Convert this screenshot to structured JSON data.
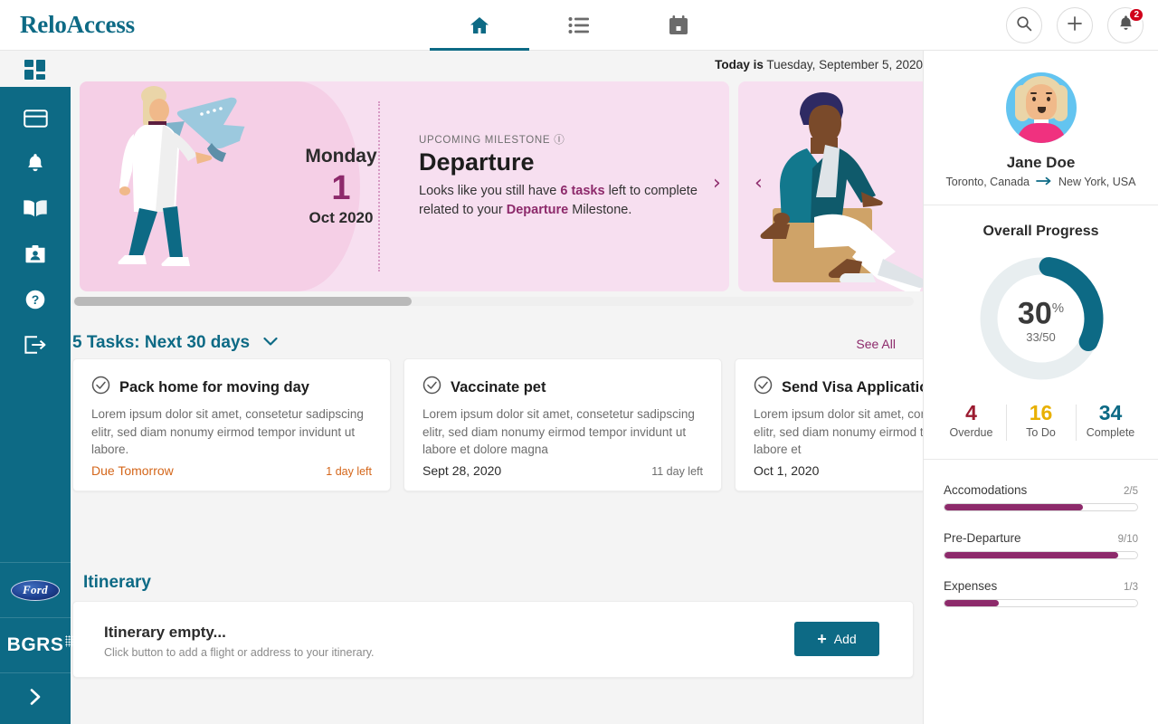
{
  "brand": {
    "logo": "ReloAccess"
  },
  "topnav": {
    "tabs": [
      {
        "icon": "home-icon",
        "label": "Home",
        "active": true
      },
      {
        "icon": "list-icon",
        "label": "Tasks",
        "active": false
      },
      {
        "icon": "calendar-icon",
        "label": "Calendar",
        "active": false
      }
    ],
    "actions": [
      {
        "icon": "search-icon",
        "label": "Search"
      },
      {
        "icon": "plus-icon",
        "label": "Add"
      },
      {
        "icon": "bell-icon",
        "label": "Notifications",
        "badge": "2"
      }
    ]
  },
  "sidebar": {
    "dashboard": {
      "icon": "dashboard-grid-icon",
      "label": "Dashboard"
    },
    "items": [
      {
        "icon": "card-icon",
        "label": "Payments"
      },
      {
        "icon": "bell-icon",
        "label": "Alerts"
      },
      {
        "icon": "book-icon",
        "label": "Guides"
      },
      {
        "icon": "contact-card-icon",
        "label": "Contacts"
      },
      {
        "icon": "help-circle-icon",
        "label": "Help"
      },
      {
        "icon": "logout-icon",
        "label": "Log out"
      }
    ],
    "logos": [
      {
        "name": "ford-logo",
        "text": "Ford"
      },
      {
        "name": "bgrs-logo",
        "text": "BGRS"
      }
    ],
    "expand": {
      "icon": "chevron-right-icon",
      "label": "Expand menu"
    }
  },
  "main": {
    "today_prefix": "Today is",
    "today_date": "Tuesday, September 5, 2020",
    "carousel": {
      "cards": [
        {
          "day": "Monday",
          "date_num": "1",
          "month_year": "Oct 2020",
          "kicker": "UPCOMING MILESTONE",
          "title": "Departure",
          "desc_1": "Looks like you still have ",
          "desc_b1": "6 tasks",
          "desc_2": " left to complete related to your ",
          "desc_b2": "Departure",
          "desc_3": " Milestone.",
          "illustration": "woman-walking-with-airplane"
        },
        {
          "illustration": "man-sitting-on-box"
        }
      ],
      "next_arrow": "›",
      "prev_arrow": "‹"
    },
    "tasks": {
      "heading": "5 Tasks: Next 30 days",
      "see_all": "See All",
      "cards": [
        {
          "title": "Pack home for moving day",
          "desc": "Lorem ipsum dolor sit amet, consetetur sadipscing elitr, sed diam nonumy eirmod tempor invidunt ut labore.",
          "date": "Due Tomorrow",
          "time_left": "1 day left",
          "overdue": true
        },
        {
          "title": "Vaccinate pet",
          "desc": "Lorem ipsum dolor sit amet, consetetur sadipscing elitr, sed diam nonumy eirmod tempor invidunt ut labore et dolore magna",
          "date": "Sept 28, 2020",
          "time_left": "11 day left",
          "overdue": false
        },
        {
          "title": "Send Visa Application",
          "desc": "Lorem ipsum dolor sit amet, consetetur sadipscing elitr, sed diam nonumy eirmod tempor invidunt ut labore et",
          "date": "Oct 1, 2020",
          "time_left": "",
          "overdue": false
        }
      ]
    },
    "itinerary": {
      "heading": "Itinerary",
      "empty_title": "Itinerary empty...",
      "empty_sub": "Click button to add a flight or address to your itinerary.",
      "add_label": "Add"
    }
  },
  "panel": {
    "avatar": "user-avatar-jane-doe",
    "name": "Jane Doe",
    "origin": "Toronto, Canada",
    "arrow": "→",
    "destination": "New York, USA",
    "progress_title": "Overall Progress",
    "stats": [
      {
        "value": "4",
        "label": "Overdue",
        "color": "#9b1b30"
      },
      {
        "value": "16",
        "label": "To Do",
        "color": "#e8b000"
      },
      {
        "value": "34",
        "label": "Complete",
        "color": "#0d6a85"
      }
    ],
    "categories": [
      {
        "name": "Accomodations",
        "fraction": "2/5",
        "percent": 72
      },
      {
        "name": "Pre-Departure",
        "fraction": "9/10",
        "percent": 90
      },
      {
        "name": "Expenses",
        "fraction": "1/3",
        "percent": 28
      }
    ]
  },
  "chart_data": {
    "type": "pie",
    "title": "Overall Progress",
    "percent_label": "30",
    "percent_symbol": "%",
    "fraction_label": "33/50",
    "values": [
      30,
      70
    ],
    "categories": [
      "Complete",
      "Remaining"
    ],
    "colors": [
      "#0d6a85",
      "#e8eef0"
    ],
    "donut": true
  }
}
